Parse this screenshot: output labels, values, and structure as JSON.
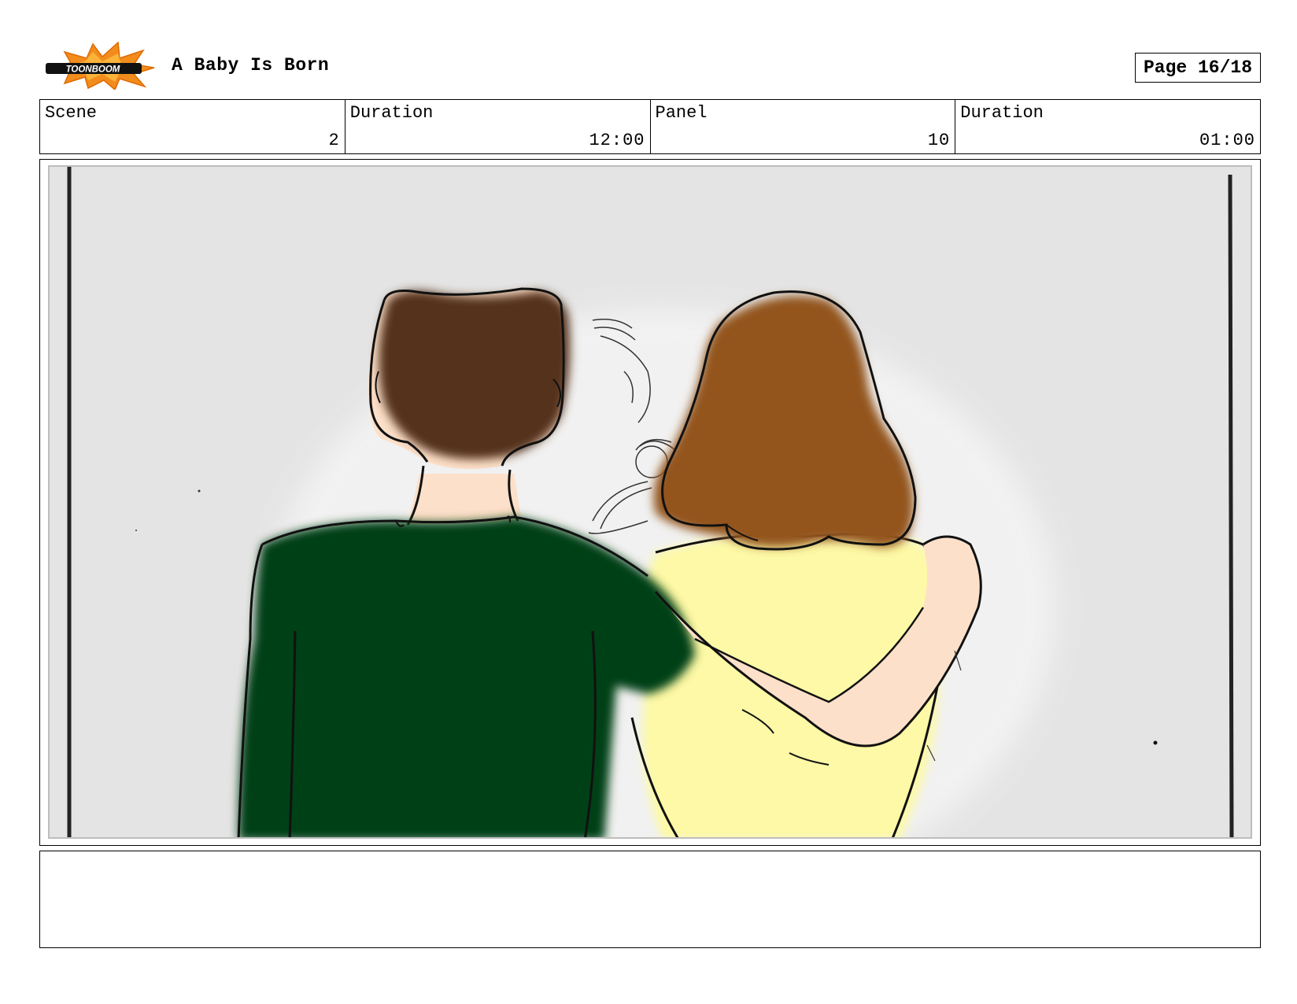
{
  "header": {
    "logo_text": "TOONBOOM",
    "title": "A Baby Is Born",
    "page_label": "Page 16/18"
  },
  "info": {
    "scene_label": "Scene",
    "scene_value": "2",
    "scene_duration_label": "Duration",
    "scene_duration_value": "12:00",
    "panel_label": "Panel",
    "panel_value": "10",
    "panel_duration_label": "Duration",
    "panel_duration_value": "01:00"
  },
  "colors": {
    "background": "#e4e4e4",
    "man_hair": "#55331a",
    "man_shirt": "#033f12",
    "woman_hair": "#93541f",
    "woman_shirt": "#fdf9a6",
    "skin": "#fde0c9",
    "logo_orange": "#f28c1c"
  },
  "notes": ""
}
